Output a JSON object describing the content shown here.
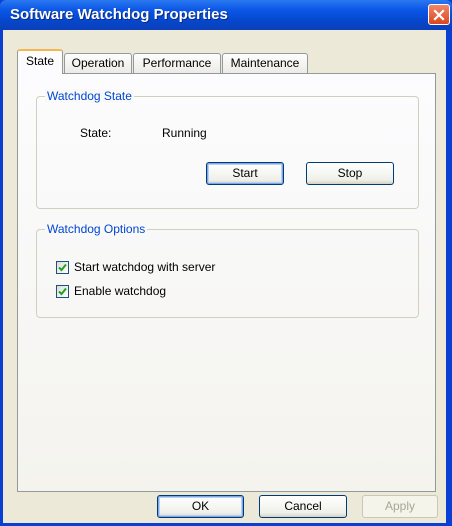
{
  "window": {
    "title": "Software Watchdog Properties"
  },
  "tabs": [
    {
      "label": "State",
      "active": true
    },
    {
      "label": "Operation",
      "active": false
    },
    {
      "label": "Performance",
      "active": false
    },
    {
      "label": "Maintenance",
      "active": false
    }
  ],
  "watchdog_state": {
    "group_title": "Watchdog State",
    "state_label": "State:",
    "state_value": "Running",
    "start_label": "Start",
    "stop_label": "Stop"
  },
  "watchdog_options": {
    "group_title": "Watchdog Options",
    "start_with_server": {
      "label": "Start watchdog with server",
      "checked": true
    },
    "enable_watchdog": {
      "label": "Enable watchdog",
      "checked": true
    }
  },
  "footer": {
    "ok_label": "OK",
    "cancel_label": "Cancel",
    "apply_label": "Apply"
  },
  "icons": {
    "close": "close-icon",
    "check": "checkmark-icon"
  },
  "colors": {
    "titlebar": "#0a55e6",
    "group_title": "#0046d5",
    "active_tab_accent": "#f7b64c",
    "checkmark": "#21a121",
    "close_button": "#d9471e"
  }
}
